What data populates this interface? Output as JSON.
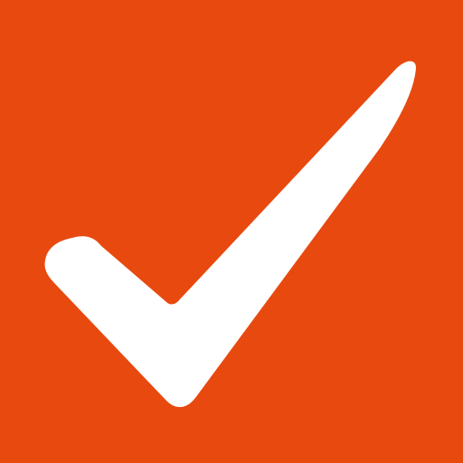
{
  "icon": {
    "name": "checkmark-icon",
    "background_color": "#E8490F",
    "mark_color": "#FFFFFF"
  }
}
